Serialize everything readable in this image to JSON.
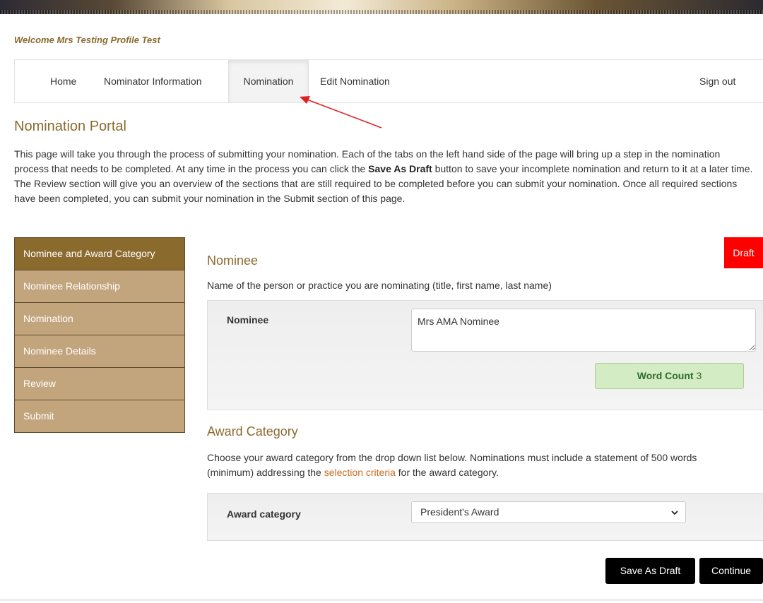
{
  "welcome": "Welcome Mrs Testing Profile Test",
  "nav": {
    "home": "Home",
    "nominator_information": "Nominator Information",
    "nomination": "Nomination",
    "edit_nomination": "Edit Nomination",
    "sign_out": "Sign out"
  },
  "portal": {
    "title": "Nomination Portal",
    "intro_1": "This page will take you through the process of submitting your nomination.  Each of the tabs on the left hand side of the page will bring up a step in the nomination process that needs to be completed.  At any time in the process you can click the ",
    "intro_bold": "Save As Draft",
    "intro_2": " button to save your incomplete nomination and return to it at a later time.  The Review section will give you an overview of the sections that are still required to be completed before you can submit your nomination.  Once all required sections have been completed, you can submit your nomination in the Submit section of this page."
  },
  "sidebar": {
    "items": [
      {
        "label": "Nominee and Award Category"
      },
      {
        "label": "Nominee Relationship"
      },
      {
        "label": "Nomination"
      },
      {
        "label": "Nominee Details"
      },
      {
        "label": "Review"
      },
      {
        "label": "Submit"
      }
    ]
  },
  "status_badge": "Draft",
  "nominee": {
    "title": "Nominee",
    "description": "Name of the person or practice you are nominating (title, first name, last name)",
    "field_label": "Nominee",
    "value": "Mrs AMA Nominee",
    "word_count_label": "Word Count",
    "word_count_value": "3"
  },
  "award": {
    "title": "Award Category",
    "description_1": "Choose your award category from the drop down list below. Nominations must include a statement of 500 words (minimum) addressing the ",
    "link_text": "selection criteria",
    "description_2": " for the award category.",
    "field_label": "Award category",
    "selected": "President's Award"
  },
  "buttons": {
    "save_draft": "Save As Draft",
    "continue": "Continue"
  },
  "colors": {
    "brand": "#8b6a2e",
    "sidebar": "#c2a57c",
    "draft": "#ff0000",
    "link": "#c76b1d",
    "annotation_arrow": "#e02020"
  }
}
